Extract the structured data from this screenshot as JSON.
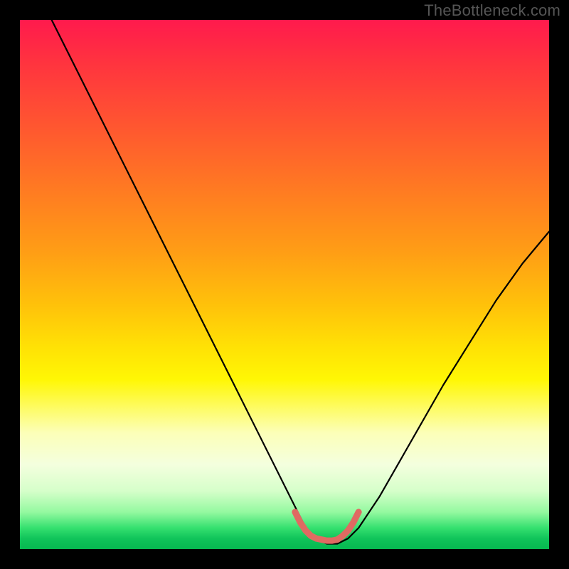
{
  "watermark": "TheBottleneck.com",
  "chart_data": {
    "type": "line",
    "title": "",
    "xlabel": "",
    "ylabel": "",
    "xlim": [
      0,
      100
    ],
    "ylim": [
      0,
      100
    ],
    "grid": false,
    "background_gradient": "red-to-green vertical (bottleneck heatmap)",
    "series": [
      {
        "name": "bottleneck-curve",
        "color": "#000000",
        "x": [
          6,
          10,
          15,
          20,
          25,
          30,
          35,
          40,
          45,
          50,
          52,
          54,
          56,
          58,
          60,
          62,
          64,
          68,
          72,
          76,
          80,
          85,
          90,
          95,
          100
        ],
        "y": [
          100,
          92,
          82,
          72,
          62,
          52,
          42,
          32,
          22,
          12,
          8,
          4,
          2,
          1,
          1,
          2,
          4,
          10,
          17,
          24,
          31,
          39,
          47,
          54,
          60
        ]
      },
      {
        "name": "optimum-highlight",
        "color": "#e06a62",
        "x": [
          52,
          53,
          54,
          55,
          56,
          57,
          58,
          59,
          60,
          61,
          62,
          63,
          64
        ],
        "y": [
          7,
          5,
          3.5,
          2.5,
          2,
          1.8,
          1.6,
          1.6,
          1.8,
          2.5,
          3.5,
          5,
          7
        ]
      }
    ]
  }
}
